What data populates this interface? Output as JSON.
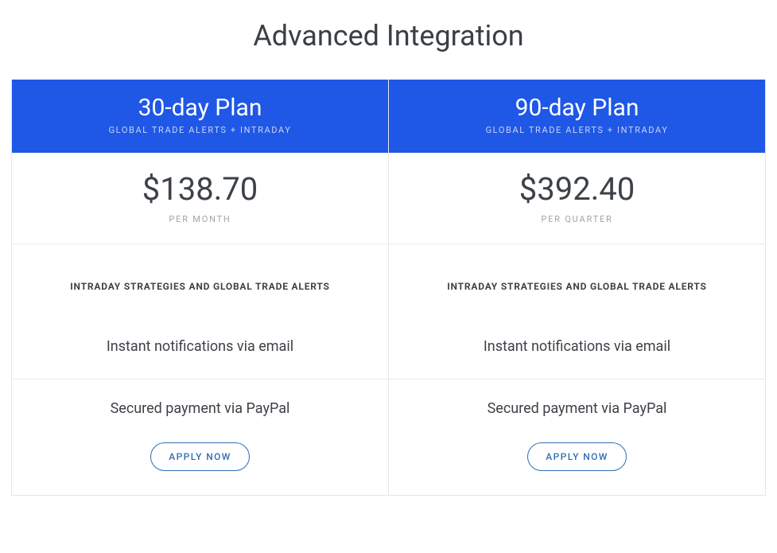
{
  "title": "Advanced Integration",
  "plans": [
    {
      "name": "30-day Plan",
      "sub": "GLOBAL TRADE ALERTS + INTRADAY",
      "price": "$138.70",
      "period": "PER MONTH",
      "feature_bold": "INTRADAY STRATEGIES AND GLOBAL TRADE ALERTS",
      "feature1": "Instant notifications via email",
      "feature2": "Secured payment via PayPal",
      "button": "APPLY NOW"
    },
    {
      "name": "90-day Plan",
      "sub": "GLOBAL TRADE ALERTS + INTRADAY",
      "price": "$392.40",
      "period": "PER QUARTER",
      "feature_bold": "INTRADAY STRATEGIES AND GLOBAL TRADE ALERTS",
      "feature1": "Instant notifications via email",
      "feature2": "Secured payment via PayPal",
      "button": "APPLY NOW"
    }
  ]
}
